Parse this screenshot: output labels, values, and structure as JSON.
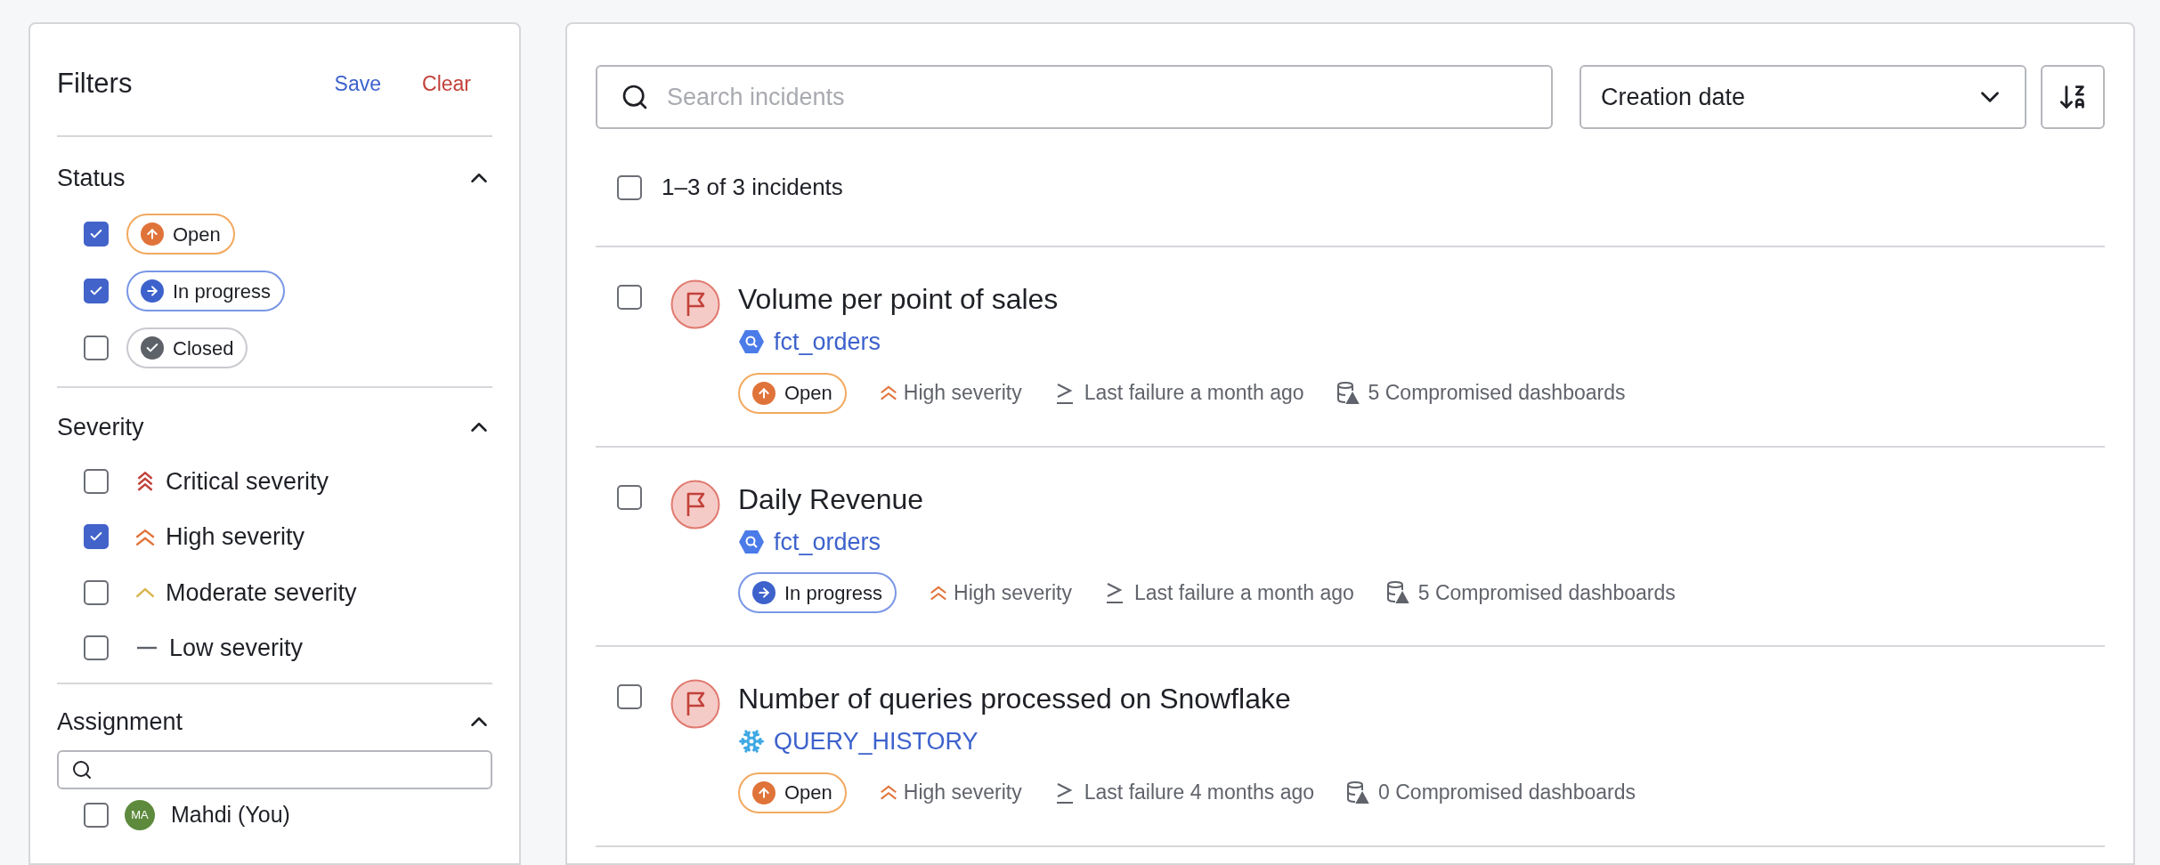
{
  "filters": {
    "title": "Filters",
    "save": "Save",
    "clear": "Clear",
    "status": {
      "title": "Status",
      "expanded": true,
      "items": [
        {
          "label": "Open",
          "kind": "open",
          "checked": true
        },
        {
          "label": "In progress",
          "kind": "in_progress",
          "checked": true
        },
        {
          "label": "Closed",
          "kind": "closed",
          "checked": false
        }
      ]
    },
    "severity": {
      "title": "Severity",
      "expanded": true,
      "items": [
        {
          "label": "Critical severity",
          "kind": "critical",
          "checked": false
        },
        {
          "label": "High severity",
          "kind": "high",
          "checked": true
        },
        {
          "label": "Moderate severity",
          "kind": "moderate",
          "checked": false
        },
        {
          "label": "Low severity",
          "kind": "low",
          "checked": false
        }
      ]
    },
    "assignment": {
      "title": "Assignment",
      "expanded": true,
      "users": [
        {
          "initials": "MA",
          "name": "Mahdi (You)",
          "checked": false
        }
      ]
    }
  },
  "main": {
    "search": {
      "placeholder": "Search incidents"
    },
    "sort": {
      "value": "Creation date"
    },
    "summary": {
      "text": "1–3 of 3 incidents",
      "checked": false
    },
    "incidents": [
      {
        "title": "Volume per point of sales",
        "checked": false,
        "dataset": {
          "name": "fct_orders",
          "kind": "bigquery"
        },
        "status": {
          "label": "Open",
          "kind": "open"
        },
        "severity": {
          "label": "High severity",
          "kind": "high"
        },
        "last_failure": "Last failure a month ago",
        "dashboards": "5 Compromised dashboards"
      },
      {
        "title": "Daily Revenue",
        "checked": false,
        "dataset": {
          "name": "fct_orders",
          "kind": "bigquery"
        },
        "status": {
          "label": "In progress",
          "kind": "in_progress"
        },
        "severity": {
          "label": "High severity",
          "kind": "high"
        },
        "last_failure": "Last failure a month ago",
        "dashboards": "5 Compromised dashboards"
      },
      {
        "title": "Number of queries processed on Snowflake",
        "checked": false,
        "dataset": {
          "name": "QUERY_HISTORY",
          "kind": "snowflake"
        },
        "status": {
          "label": "Open",
          "kind": "open"
        },
        "severity": {
          "label": "High severity",
          "kind": "high"
        },
        "last_failure": "Last failure 4 months ago",
        "dashboards": "0 Compromised dashboards"
      }
    ]
  }
}
